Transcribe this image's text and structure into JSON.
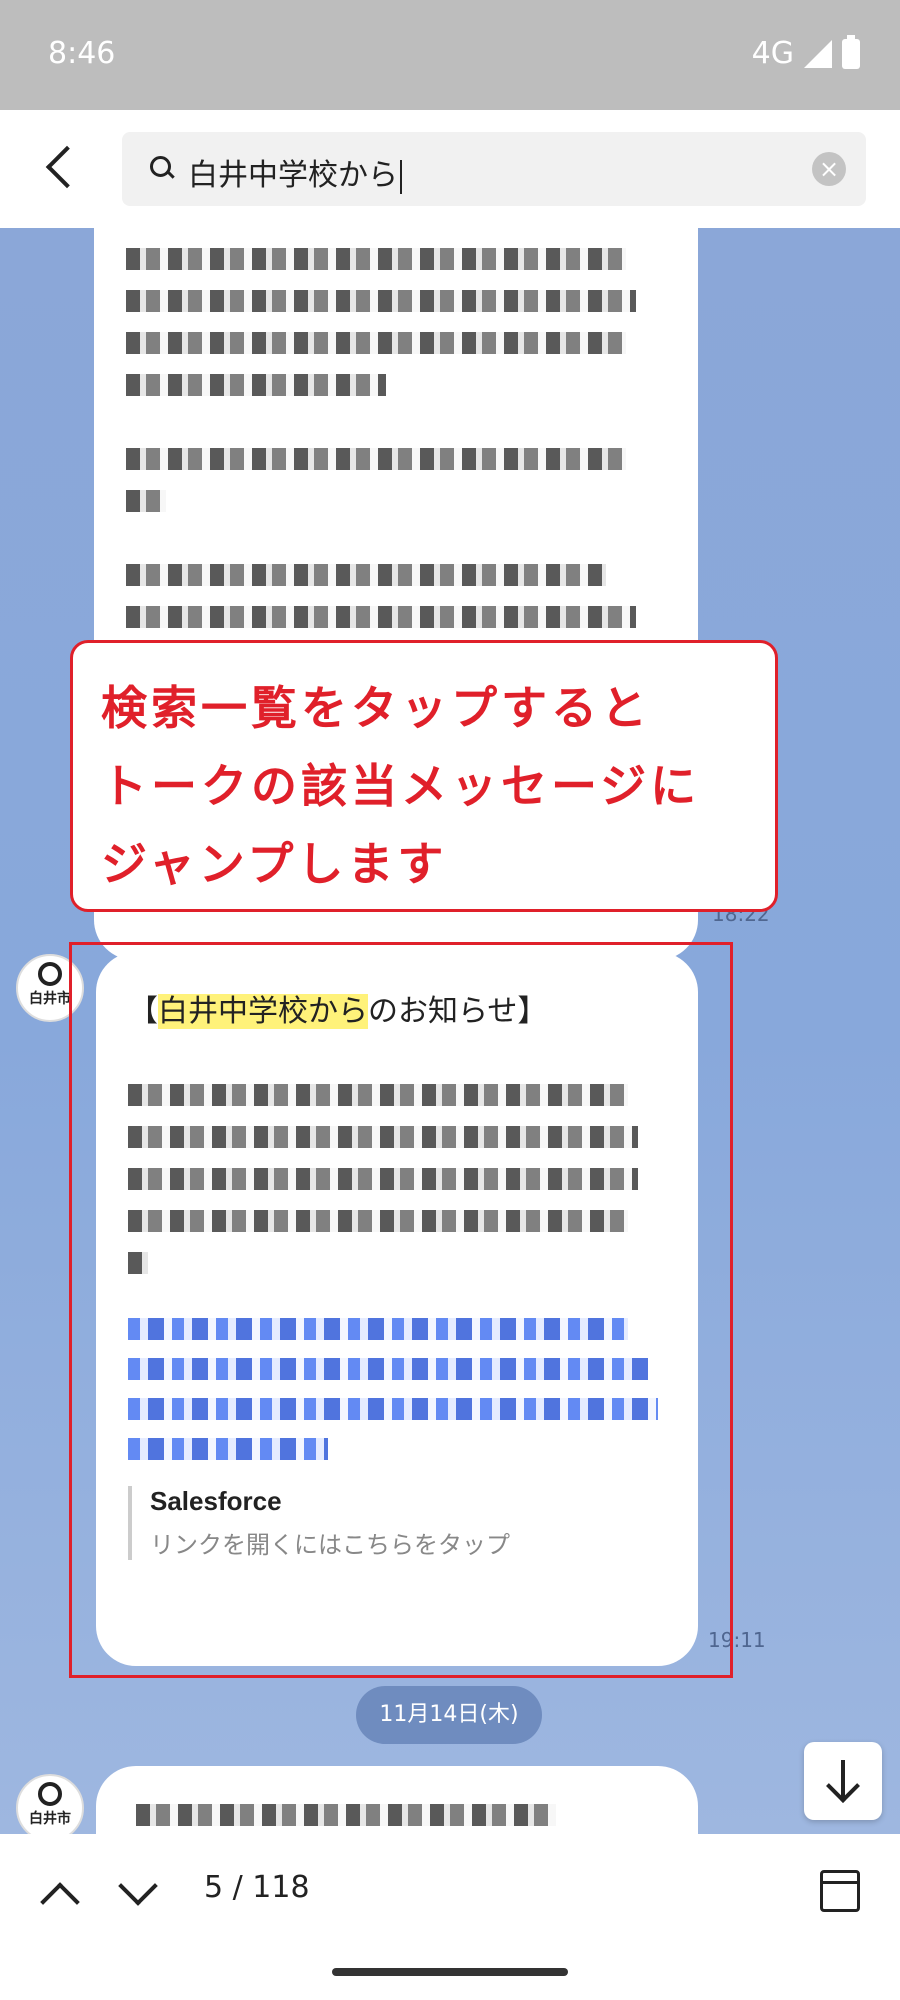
{
  "status_bar": {
    "time": "8:46",
    "network": "4G",
    "icons": [
      "signal-icon",
      "battery-icon"
    ]
  },
  "search": {
    "query": "白井中学校から",
    "icon": "search-icon",
    "clear_icon": "close-icon"
  },
  "messages": {
    "upper_timestamp": "18:22",
    "highlighted_message": {
      "title_prefix": "【",
      "title_highlight": "白井中学校から",
      "title_suffix": "のお知らせ】",
      "link_card": {
        "site_name": "Salesforce",
        "hint": "リンクを開くにはこちらをタップ"
      },
      "timestamp": "19:11"
    },
    "date_separator": "11月14日(木)",
    "sender_avatar_label": "白井市"
  },
  "annotation": {
    "lines": [
      "検索一覧をタップすると",
      "トークの該当メッセージに",
      "ジャンプします"
    ],
    "color": "#e0202a"
  },
  "bottom_bar": {
    "result_counter": "5 / 118",
    "icons": [
      "chevron-up-icon",
      "chevron-down-icon",
      "calendar-icon"
    ]
  },
  "colors": {
    "chat_background": "#8ba7d8",
    "highlight": "#fff27a",
    "accent_red": "#e0202a",
    "link_blue": "#2451d6"
  }
}
